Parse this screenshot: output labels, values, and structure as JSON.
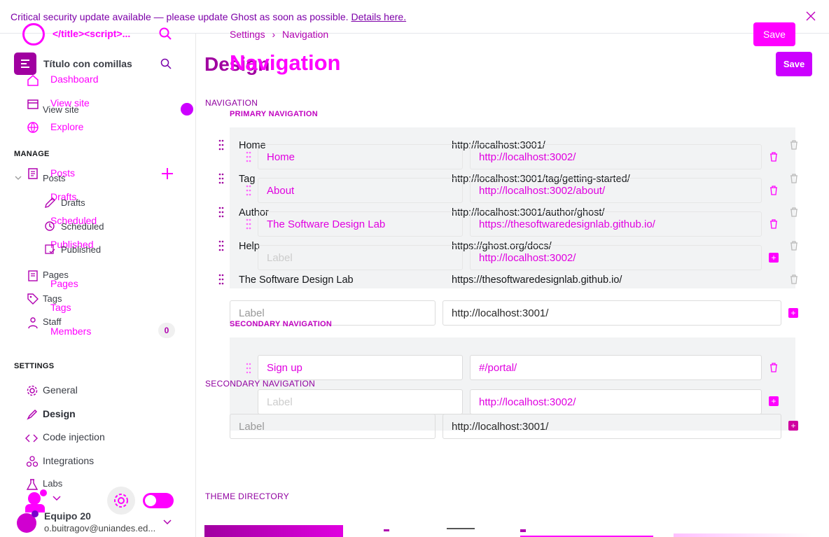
{
  "banner": {
    "message": "Critical security update available — please update Ghost as soon as possible.",
    "link": "Details here."
  },
  "sidebar": {
    "site_title_overlay": "</title><script>...",
    "site_title": "Título con comillas",
    "top_items": [
      {
        "label": "Dashboard",
        "icon": "home-icon"
      },
      {
        "label": "View site",
        "overlay": "View site",
        "icon": "view-site-icon"
      },
      {
        "label": "Explore",
        "icon": "globe-icon"
      }
    ],
    "manage_heading": "MANAGE",
    "posts": {
      "label": "Posts",
      "overlay": "Posts"
    },
    "drafts": {
      "label": "Drafts",
      "overlay": "Drafts"
    },
    "scheduled": {
      "label": "Scheduled",
      "overlay": "Scheduled"
    },
    "published": {
      "label": "Published",
      "overlay": "Published"
    },
    "pages": {
      "label": "Pages",
      "overlay": "Pages"
    },
    "tags": {
      "label": "Tags",
      "overlay": "Tags"
    },
    "staff": {
      "label": "Staff"
    },
    "members": {
      "label": "Members",
      "count": "0"
    },
    "settings_heading": "SETTINGS",
    "settings_items": [
      "General",
      "Design",
      "Code injection",
      "Integrations",
      "Labs"
    ],
    "user": {
      "name": "Equipo 20",
      "email": "o.buitragov@uniandes.ed..."
    }
  },
  "main": {
    "breadcrumb_root": "Settings",
    "breadcrumb_sep": "›",
    "breadcrumb_current": "Navigation",
    "title_underlay": "Design",
    "title": "Navigation",
    "save": "Save",
    "section_navigation": "NAVIGATION",
    "primary_heading": "PRIMARY NAVIGATION",
    "secondary_heading_overlay": "SECONDARY NAVIGATION",
    "secondary_heading": "SECONDARY NAVIGATION",
    "theme_directory": "THEME DIRECTORY",
    "primary_items": [
      {
        "label": "Home",
        "url": "http://localhost:3001/"
      },
      {
        "label": "Tag",
        "url": "http://localhost:3001/tag/getting-started/"
      },
      {
        "label": "Author",
        "url": "http://localhost:3001/author/ghost/"
      },
      {
        "label": "Help",
        "url": "https://ghost.org/docs/"
      },
      {
        "label": "The Software Design Lab",
        "url": "https://thesoftwaredesignlab.github.io/"
      }
    ],
    "primary_new": {
      "placeholder": "Label",
      "url": "http://localhost:3001/"
    },
    "overlay_primary_items": [
      {
        "label": "Home",
        "url": "http://localhost:3002/"
      },
      {
        "label": "About",
        "url": "http://localhost:3002/about/"
      },
      {
        "label": "The Software Design Lab",
        "url": "https://thesoftwaredesignlab.github.io/"
      }
    ],
    "overlay_primary_new": {
      "placeholder": "Label",
      "url": "http://localhost:3002/"
    },
    "overlay_secondary_items": [
      {
        "label": "Sign up",
        "url": "#/portal/"
      }
    ],
    "overlay_secondary_new": {
      "placeholder": "Label",
      "url": "http://localhost:3002/"
    },
    "secondary_new": {
      "placeholder": "Label",
      "url": "http://localhost:3001/"
    }
  },
  "colors": {
    "accent": "#ff00ff",
    "brand": "#cc00ff"
  }
}
